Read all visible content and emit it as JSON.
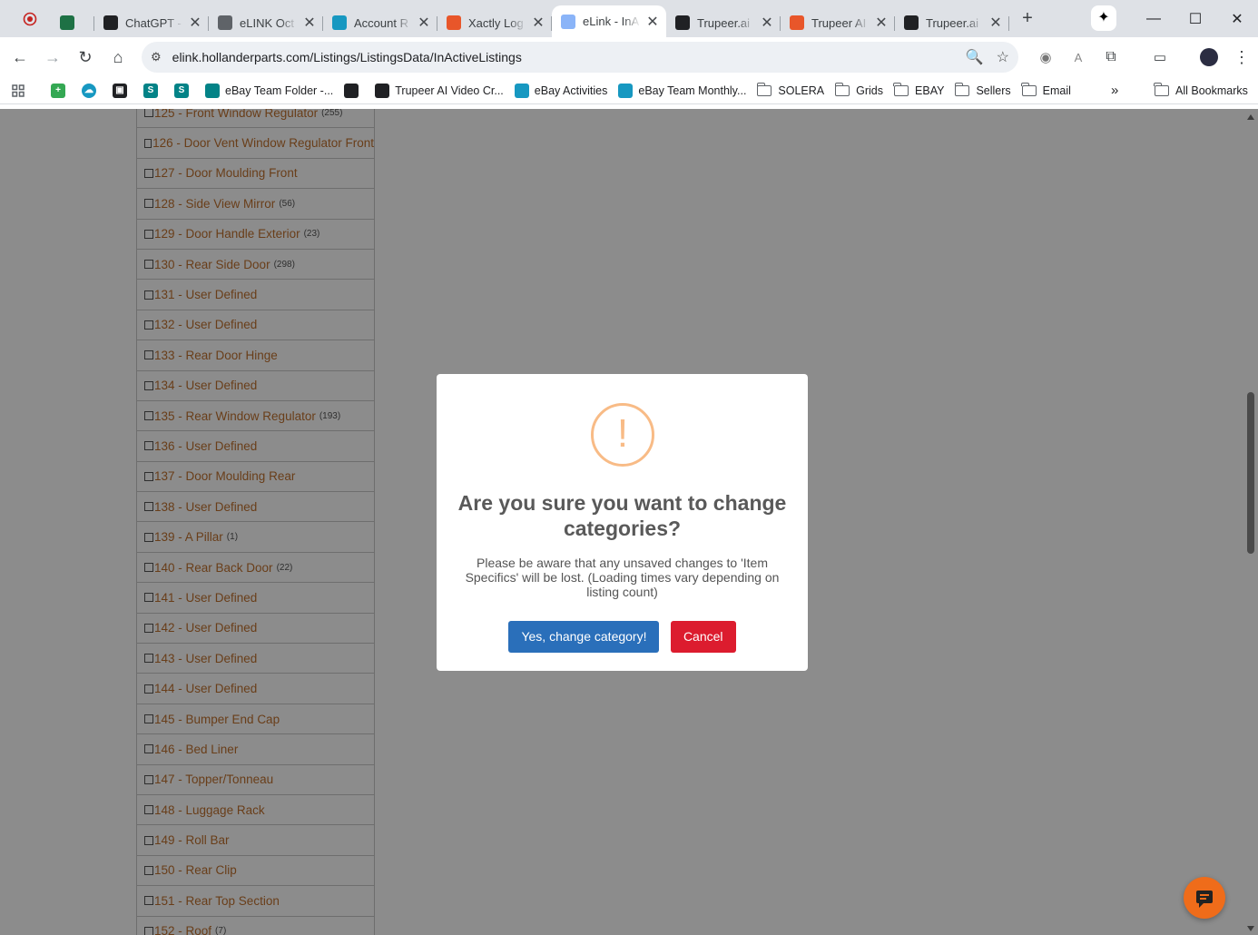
{
  "browser": {
    "tabs": [
      {
        "title": "",
        "favicon": "excel-icon",
        "color": "#1e7145"
      },
      {
        "title": "ChatGPT -",
        "favicon": "chatgpt-icon",
        "color": "#202124"
      },
      {
        "title": "eLINK Oct",
        "favicon": "globe-icon",
        "color": "#5f6368"
      },
      {
        "title": "Account R",
        "favicon": "salesforce-icon",
        "color": "#1798c1"
      },
      {
        "title": "Xactly Log",
        "favicon": "xactly-icon",
        "color": "#e8562a"
      },
      {
        "title": "eLink - InA",
        "favicon": "page-icon",
        "color": "#8ab4f8",
        "active": true
      },
      {
        "title": "Trupeer.ai",
        "favicon": "trupeer-icon",
        "color": "#202124"
      },
      {
        "title": "Trupeer AI",
        "favicon": "rainbow-icon",
        "color": "#e8562a"
      },
      {
        "title": "Trupeer.ai",
        "favicon": "trupeer-icon",
        "color": "#202124"
      }
    ],
    "url": "elink.hollanderparts.com/Listings/ListingsData/InActiveListings"
  },
  "bookmarks": [
    {
      "label": "eBay Team Folder -...",
      "icon": "sharepoint-icon",
      "color": "#038387"
    },
    {
      "label": "",
      "icon": "chatgpt-icon",
      "color": "#202124"
    },
    {
      "label": "Trupeer AI Video Cr...",
      "icon": "trupeer-icon",
      "color": "#202124"
    },
    {
      "label": "eBay Activities",
      "icon": "salesforce-icon",
      "color": "#1798c1"
    },
    {
      "label": "eBay Team Monthly...",
      "icon": "salesforce-icon",
      "color": "#1798c1"
    },
    {
      "label": "SOLERA",
      "icon": "folder-icon"
    },
    {
      "label": "Grids",
      "icon": "folder-icon"
    },
    {
      "label": "EBAY",
      "icon": "folder-icon"
    },
    {
      "label": "Sellers",
      "icon": "folder-icon"
    },
    {
      "label": "Email",
      "icon": "folder-icon"
    }
  ],
  "all_bookmarks_label": "All Bookmarks",
  "categories": [
    {
      "label": "125 - Front Window Regulator",
      "count": "(255)"
    },
    {
      "label": "126 - Door Vent Window Regulator Front",
      "count": ""
    },
    {
      "label": "127 - Door Moulding Front",
      "count": ""
    },
    {
      "label": "128 - Side View Mirror",
      "count": "(56)"
    },
    {
      "label": "129 - Door Handle Exterior",
      "count": "(23)"
    },
    {
      "label": "130 - Rear Side Door",
      "count": "(298)"
    },
    {
      "label": "131 - User Defined",
      "count": ""
    },
    {
      "label": "132 - User Defined",
      "count": ""
    },
    {
      "label": "133 - Rear Door Hinge",
      "count": ""
    },
    {
      "label": "134 - User Defined",
      "count": ""
    },
    {
      "label": "135 - Rear Window Regulator",
      "count": "(193)"
    },
    {
      "label": "136 - User Defined",
      "count": ""
    },
    {
      "label": "137 - Door Moulding Rear",
      "count": ""
    },
    {
      "label": "138 - User Defined",
      "count": ""
    },
    {
      "label": "139 - A Pillar",
      "count": "(1)"
    },
    {
      "label": "140 - Rear Back Door",
      "count": "(22)"
    },
    {
      "label": "141 - User Defined",
      "count": ""
    },
    {
      "label": "142 - User Defined",
      "count": ""
    },
    {
      "label": "143 - User Defined",
      "count": ""
    },
    {
      "label": "144 - User Defined",
      "count": ""
    },
    {
      "label": "145 - Bumper End Cap",
      "count": ""
    },
    {
      "label": "146 - Bed Liner",
      "count": ""
    },
    {
      "label": "147 - Topper/Tonneau",
      "count": ""
    },
    {
      "label": "148 - Luggage Rack",
      "count": ""
    },
    {
      "label": "149 - Roll Bar",
      "count": ""
    },
    {
      "label": "150 - Rear Clip",
      "count": ""
    },
    {
      "label": "151 - Rear Top Section",
      "count": ""
    },
    {
      "label": "152 - Roof",
      "count": "(7)"
    }
  ],
  "dialog": {
    "icon": "warning-icon",
    "icon_glyph": "!",
    "title": "Are you sure you want to change categories?",
    "text": "Please be aware that any unsaved changes to 'Item Specifics' will be lost. (Loading times vary depending on listing count)",
    "confirm_label": "Yes, change category!",
    "cancel_label": "Cancel"
  },
  "colors": {
    "confirm": "#2a6fba",
    "cancel": "#dc1c2e",
    "warning": "#f8bb86",
    "link": "#c0712f",
    "chat": "#ef6c1a"
  }
}
